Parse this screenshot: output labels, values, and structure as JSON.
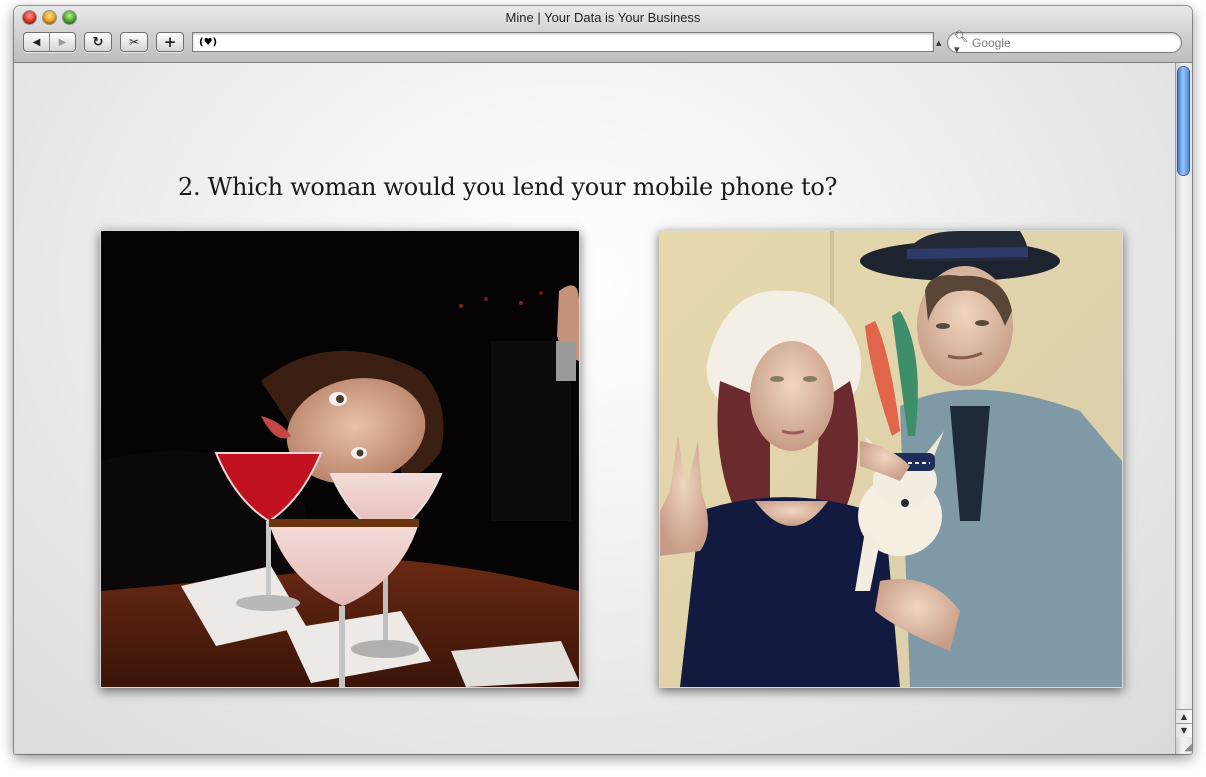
{
  "window": {
    "title": "Mine | Your Data is Your Business"
  },
  "toolbar": {
    "back_icon": "◀",
    "forward_icon": "▶",
    "reload_icon": "↻",
    "snippet_icon": "✂",
    "add_icon": "+",
    "address_icon": "(♥)",
    "address_value": "",
    "search_placeholder": "Google"
  },
  "page": {
    "question": "2. Which woman would you lend your mobile phone to?",
    "photos": [
      {
        "id": "photo-1",
        "description_icon": "photo-woman-with-cocktails"
      },
      {
        "id": "photo-2",
        "description_icon": "photo-woman-with-man-and-dog"
      }
    ]
  },
  "colors": {
    "scroll_thumb": "#4d8be0",
    "content_bg": "#f3f3f3"
  }
}
